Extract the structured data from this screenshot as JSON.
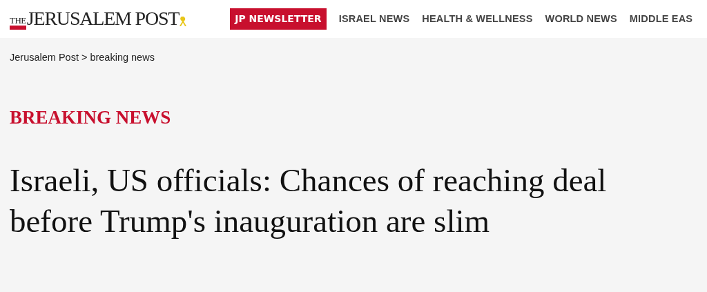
{
  "header": {
    "logo": {
      "prefix": "THE",
      "name": "JERUSALEM POST"
    },
    "nav": [
      {
        "label": "JP NEWSLETTER",
        "kind": "highlight"
      },
      {
        "label": "ISRAEL NEWS",
        "kind": "link"
      },
      {
        "label": "HEALTH & WELLNESS",
        "kind": "link"
      },
      {
        "label": "WORLD NEWS",
        "kind": "link"
      },
      {
        "label": "MIDDLE EAS",
        "kind": "link"
      }
    ]
  },
  "breadcrumb": [
    {
      "label": "Jerusalem Post",
      "separator": ">"
    },
    {
      "label": "breaking news"
    }
  ],
  "section": "BREAKING NEWS",
  "headline": "Israeli, US officials: Chances of reaching deal before Trump's inauguration are slim"
}
